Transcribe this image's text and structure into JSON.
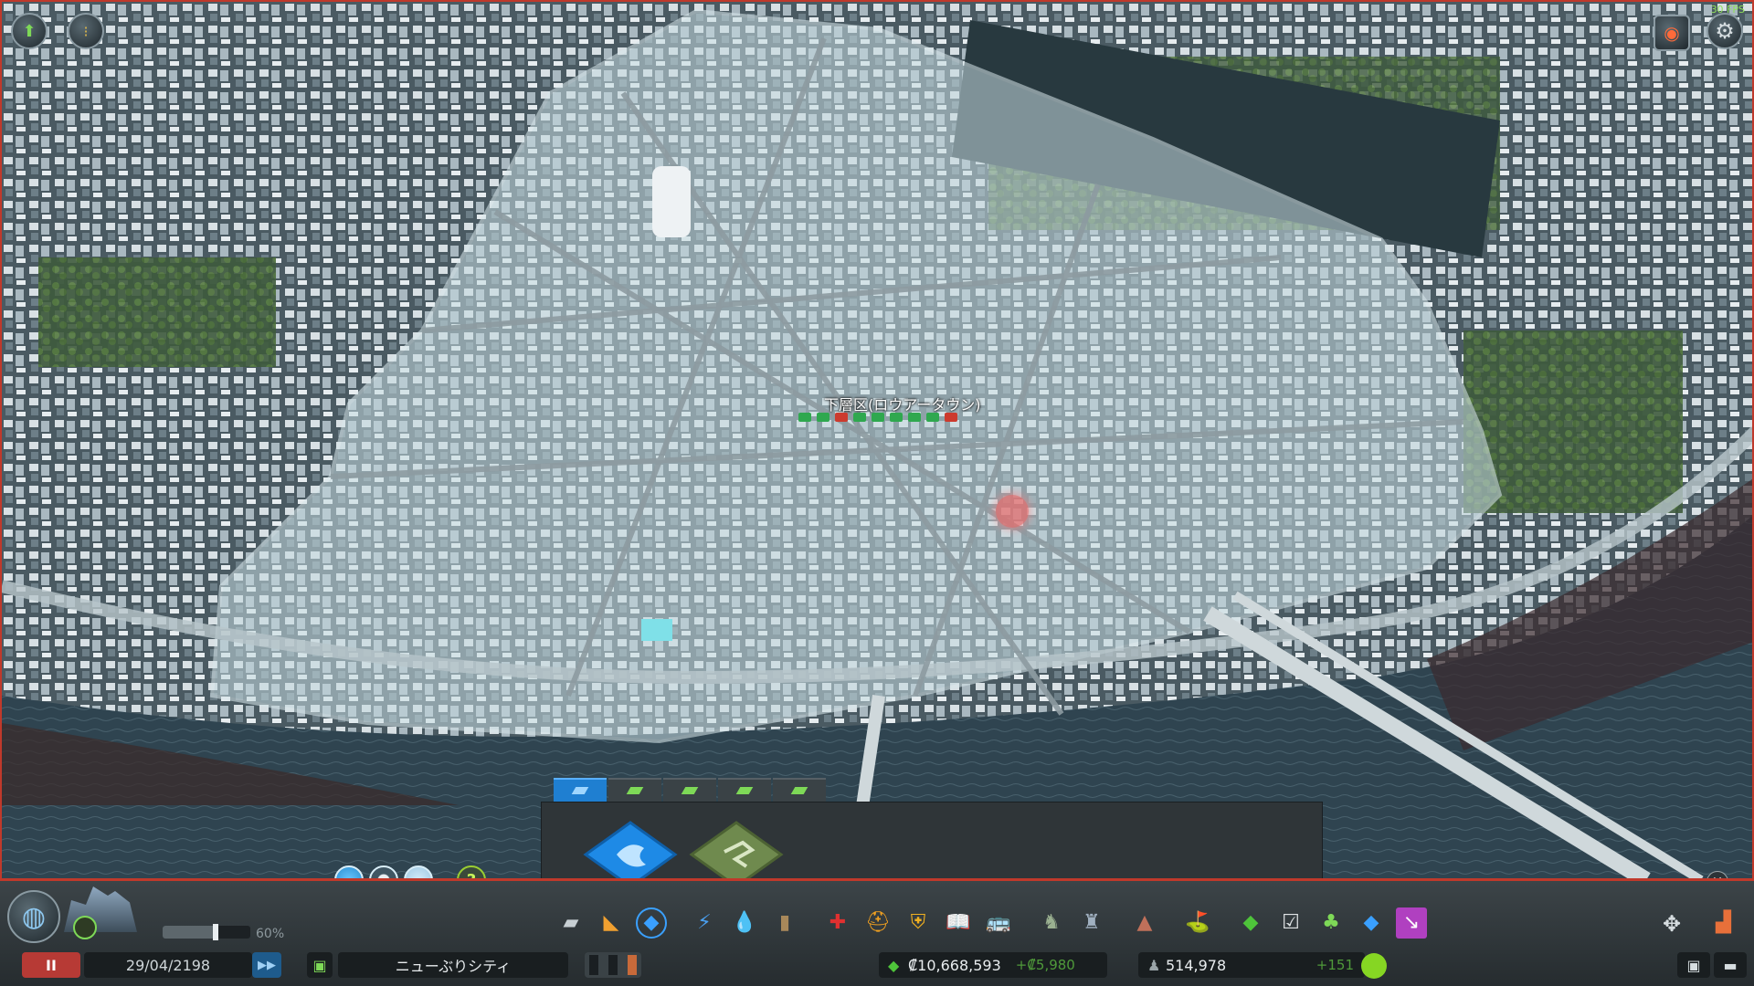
{
  "hud": {
    "fps": "30 FPS",
    "top_left_buttons": [
      "unlock-icon",
      "traffic-light-icon"
    ],
    "top_right_buttons": [
      "camera-record-icon",
      "gear-icon"
    ]
  },
  "map": {
    "district_name": "下層区(ロウアータウン)",
    "district_policy_icons": [
      "green-policy",
      "green-policy",
      "red-policy",
      "green-policy",
      "green-policy",
      "green-policy",
      "green-policy",
      "green-policy",
      "red-policy"
    ]
  },
  "district_panel": {
    "tabs": [
      "district-paint-tab",
      "park-area-tab",
      "industry-area-tab",
      "campus-area-tab",
      "airport-area-tab"
    ],
    "active_tab": 0,
    "tools": [
      "paint-district-tool",
      "paint-park-area-tool"
    ]
  },
  "info_toggles": [
    "info-view-1",
    "info-view-2",
    "info-view-3"
  ],
  "bottom": {
    "speed_percent": 0.6,
    "speed_label": "60%",
    "date": "29/04/2198",
    "city_name": "ニューぶりシティ",
    "money": "₡10,668,593",
    "money_delta": "+₡5,980",
    "population": "514,978",
    "population_delta": "+151",
    "play_glyph": "▶▶",
    "pause_glyph": "II"
  },
  "toolbar_icons": [
    "roads-icon",
    "zoning-icon",
    "districts-icon",
    "electricity-icon",
    "water-icon",
    "garbage-icon",
    "healthcare-icon",
    "fire-icon",
    "police-icon",
    "education-icon",
    "transport-icon",
    "parks-icon",
    "unique-buildings-icon",
    "landscaping-icon",
    "disasters-icon",
    "upgrade-icon",
    "policies-icon",
    "bulldoze-tree-icon",
    "water-tool-icon",
    "move-it-icon"
  ],
  "colors": {
    "accent_red": "#c0392b",
    "district_overlay": "#b9d0d6",
    "money_positive": "#4f9a3a",
    "active_tab": "#1f7fd1"
  }
}
